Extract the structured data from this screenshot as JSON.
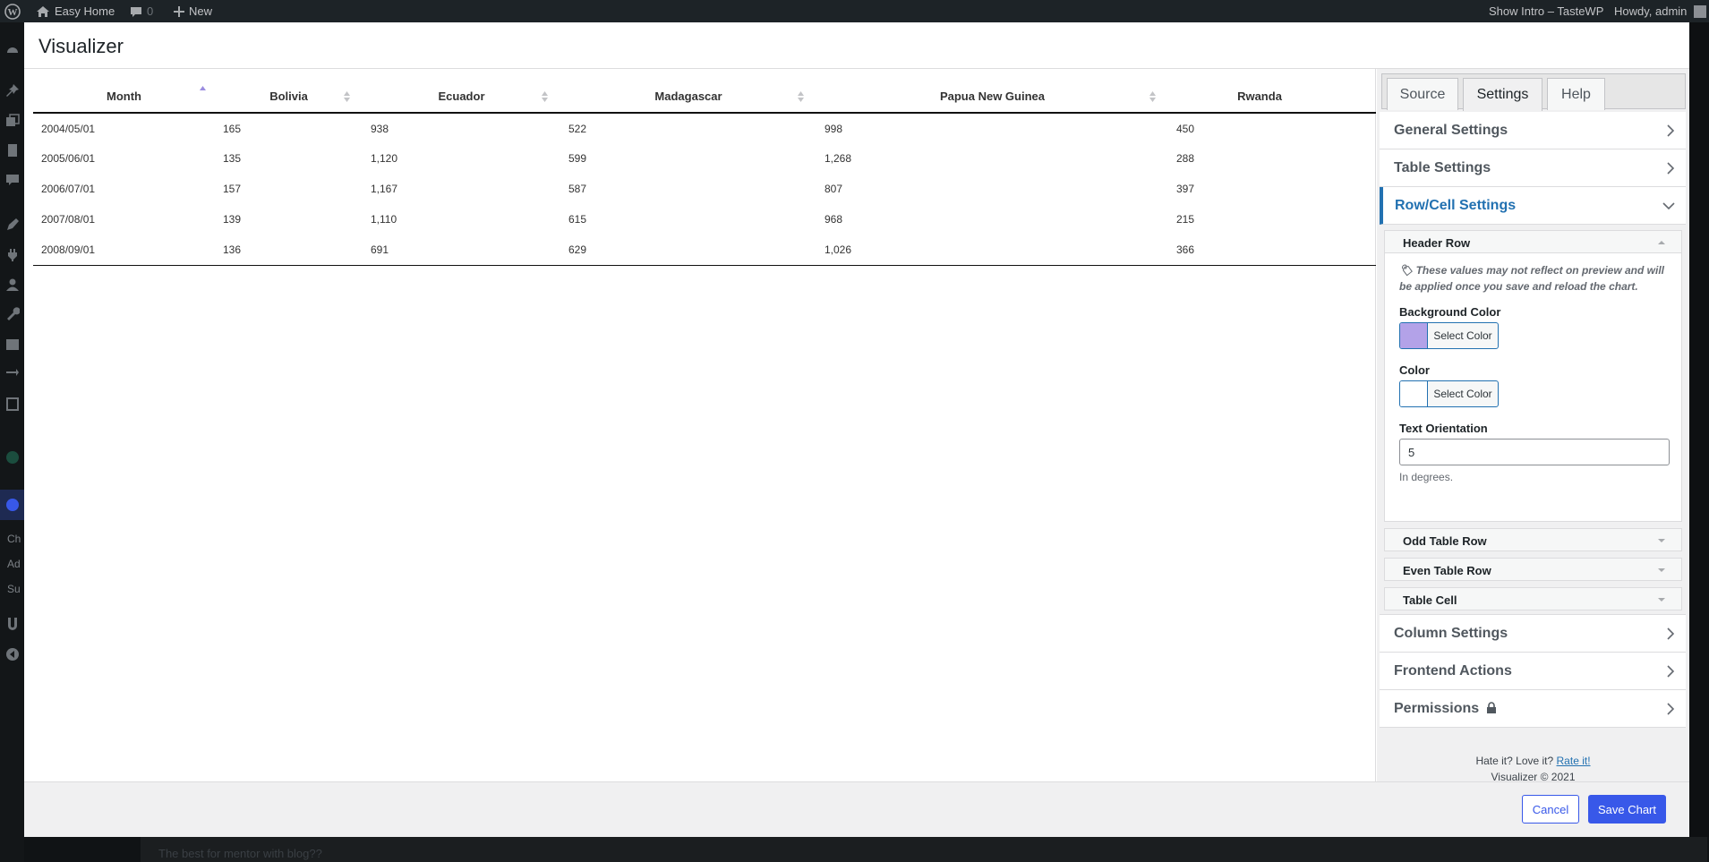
{
  "admin_bar": {
    "site_name": "Easy Home",
    "comments_count": "0",
    "new_label": "New",
    "show_intro": "Show Intro – TasteWP",
    "howdy": "Howdy, admin"
  },
  "admin_menu": {
    "sub_items": [
      "Ch",
      "Ad",
      "Su"
    ]
  },
  "modal": {
    "title": "Visualizer"
  },
  "table": {
    "columns": [
      "Month",
      "Bolivia",
      "Ecuador",
      "Madagascar",
      "Papua New Guinea",
      "Rwanda"
    ],
    "rows": [
      [
        "2004/05/01",
        "165",
        "938",
        "522",
        "998",
        "450"
      ],
      [
        "2005/06/01",
        "135",
        "1,120",
        "599",
        "1,268",
        "288"
      ],
      [
        "2006/07/01",
        "157",
        "1,167",
        "587",
        "807",
        "397"
      ],
      [
        "2007/08/01",
        "139",
        "1,110",
        "615",
        "968",
        "215"
      ],
      [
        "2008/09/01",
        "136",
        "691",
        "629",
        "1,026",
        "366"
      ]
    ]
  },
  "sidebar": {
    "tabs": [
      "Source",
      "Settings",
      "Help"
    ],
    "active_tab": "Settings",
    "groups": {
      "general": "General Settings",
      "table": "Table Settings",
      "rowcell": "Row/Cell Settings",
      "column": "Column Settings",
      "frontend": "Frontend Actions",
      "permissions": "Permissions"
    },
    "rowcell": {
      "header_row": "Header Row",
      "note": "These values may not reflect on preview and will be applied once you save and reload the chart.",
      "bg_color_label": "Background Color",
      "bg_color_value": "#b3a2e8",
      "select_color": "Select Color",
      "color_label": "Color",
      "color_value": "#ffffff",
      "text_orientation_label": "Text Orientation",
      "text_orientation_value": "5",
      "text_orientation_hint": "In degrees.",
      "odd_row": "Odd Table Row",
      "even_row": "Even Table Row",
      "table_cell": "Table Cell"
    },
    "footer": {
      "hate_love": "Hate it? Love it?",
      "rate_link": "Rate it!",
      "copyright": "Visualizer © 2021"
    }
  },
  "toolbar": {
    "cancel": "Cancel",
    "save": "Save Chart"
  },
  "bottom_strip_text": "The best for mentor with blog??",
  "colors": {
    "accent": "#3858e9",
    "link": "#2271b1",
    "admin_bar": "#1d2327"
  }
}
